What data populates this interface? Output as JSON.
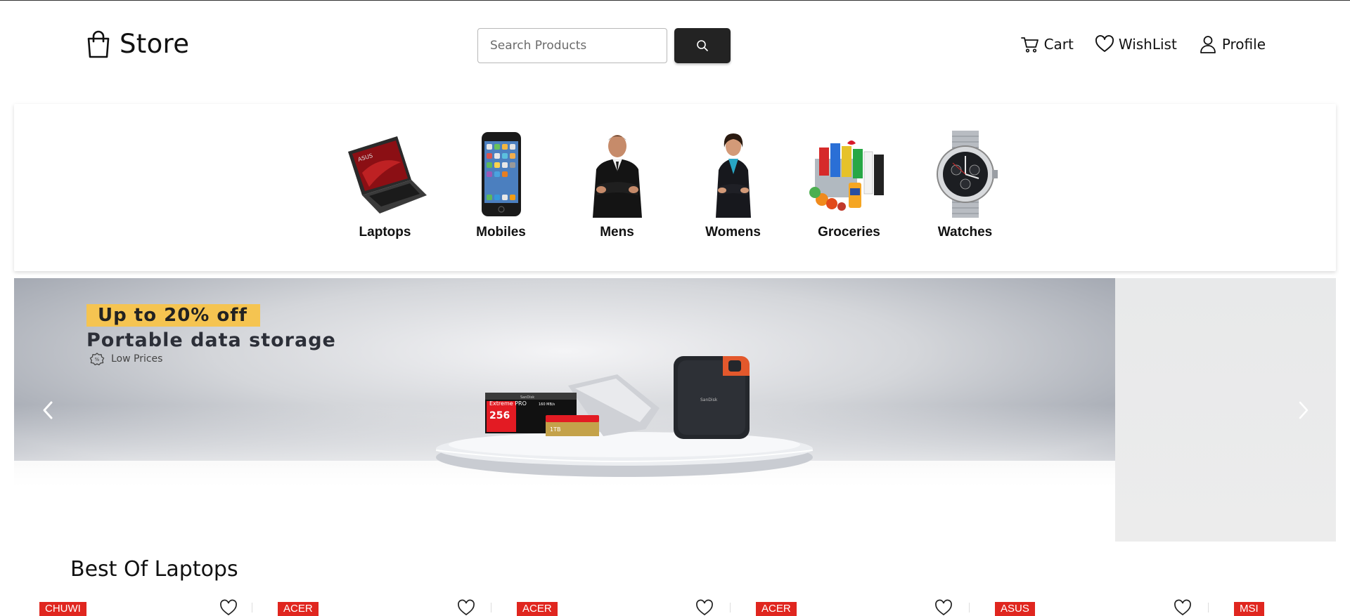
{
  "header": {
    "logo_text": "Store",
    "search": {
      "placeholder": "Search Products",
      "value": ""
    },
    "nav": [
      {
        "label": "Cart",
        "icon": "cart-icon"
      },
      {
        "label": "WishList",
        "icon": "heart-icon"
      },
      {
        "label": "Profile",
        "icon": "user-icon"
      }
    ]
  },
  "categories": [
    {
      "label": "Laptops",
      "icon": "laptop-image"
    },
    {
      "label": "Mobiles",
      "icon": "mobile-image"
    },
    {
      "label": "Mens",
      "icon": "man-image"
    },
    {
      "label": "Womens",
      "icon": "woman-image"
    },
    {
      "label": "Groceries",
      "icon": "groceries-image"
    },
    {
      "label": "Watches",
      "icon": "watch-image"
    }
  ],
  "banner": {
    "offer_tag": "Up to 20% off",
    "offer_title": "Portable data storage",
    "offer_sub": "Low Prices",
    "product_text": {
      "card_brand": "SanDisk",
      "card_name": "Extreme PRO",
      "card_capacity": "256",
      "card_speed": "160 MB/s",
      "micro_capacity": "1TB",
      "ssd_brand": "SanDisk"
    }
  },
  "section": {
    "title": "Best Of Laptops",
    "products": [
      {
        "brand": "CHUWI"
      },
      {
        "brand": "ACER"
      },
      {
        "brand": "ACER"
      },
      {
        "brand": "ACER"
      },
      {
        "brand": "ASUS"
      },
      {
        "brand": "MSI"
      }
    ]
  },
  "colors": {
    "accent_dark": "#232323",
    "badge_red": "#e0261f",
    "offer_yellow": "#f5c451"
  }
}
